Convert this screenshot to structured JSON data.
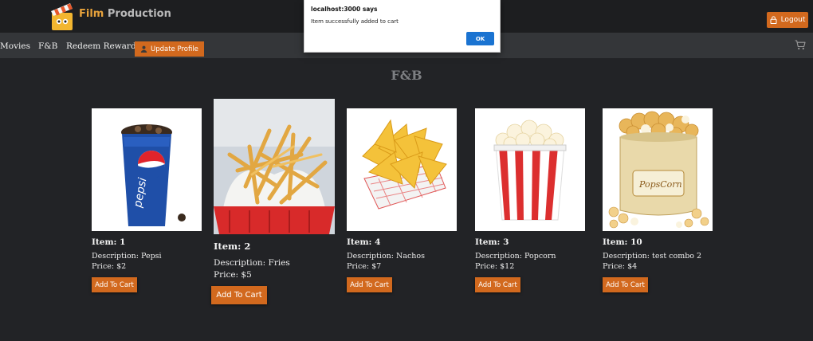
{
  "header": {
    "brand_part1": "Film",
    "brand_part2": "Production",
    "logout_label": "Logout"
  },
  "nav": {
    "items": [
      "Movies",
      "F&B",
      "Redeem Rewards"
    ],
    "update_profile_label": "Update Profile"
  },
  "page": {
    "title": "F&B"
  },
  "products": [
    {
      "title": "Item: 1",
      "description": "Description: Pepsi",
      "price": "Price: $2",
      "button": "Add To Cart",
      "image": "pepsi-cup"
    },
    {
      "title": "Item: 2",
      "description": "Description: Fries",
      "price": "Price: $5",
      "button": "Add To Cart",
      "image": "fries-basket"
    },
    {
      "title": "Item: 4",
      "description": "Description: Nachos",
      "price": "Price: $7",
      "button": "Add To Cart",
      "image": "nachos-tray"
    },
    {
      "title": "Item: 3",
      "description": "Description: Popcorn",
      "price": "Price: $12",
      "button": "Add To Cart",
      "image": "popcorn-bucket"
    },
    {
      "title": "Item: 10",
      "description": "Description: test combo 2",
      "price": "Price: $4",
      "button": "Add To Cart",
      "image": "popcorn-tin"
    }
  ],
  "dialog": {
    "title": "localhost:3000 says",
    "message": "Item successfully added to cart",
    "ok_label": "OK"
  },
  "colors": {
    "accent": "#d2691e",
    "background": "#222326",
    "navbar": "#343639",
    "dialog_button": "#1a73d1"
  },
  "icons": [
    "clapperboard-logo",
    "lock-icon",
    "user-icon",
    "cart-icon"
  ]
}
